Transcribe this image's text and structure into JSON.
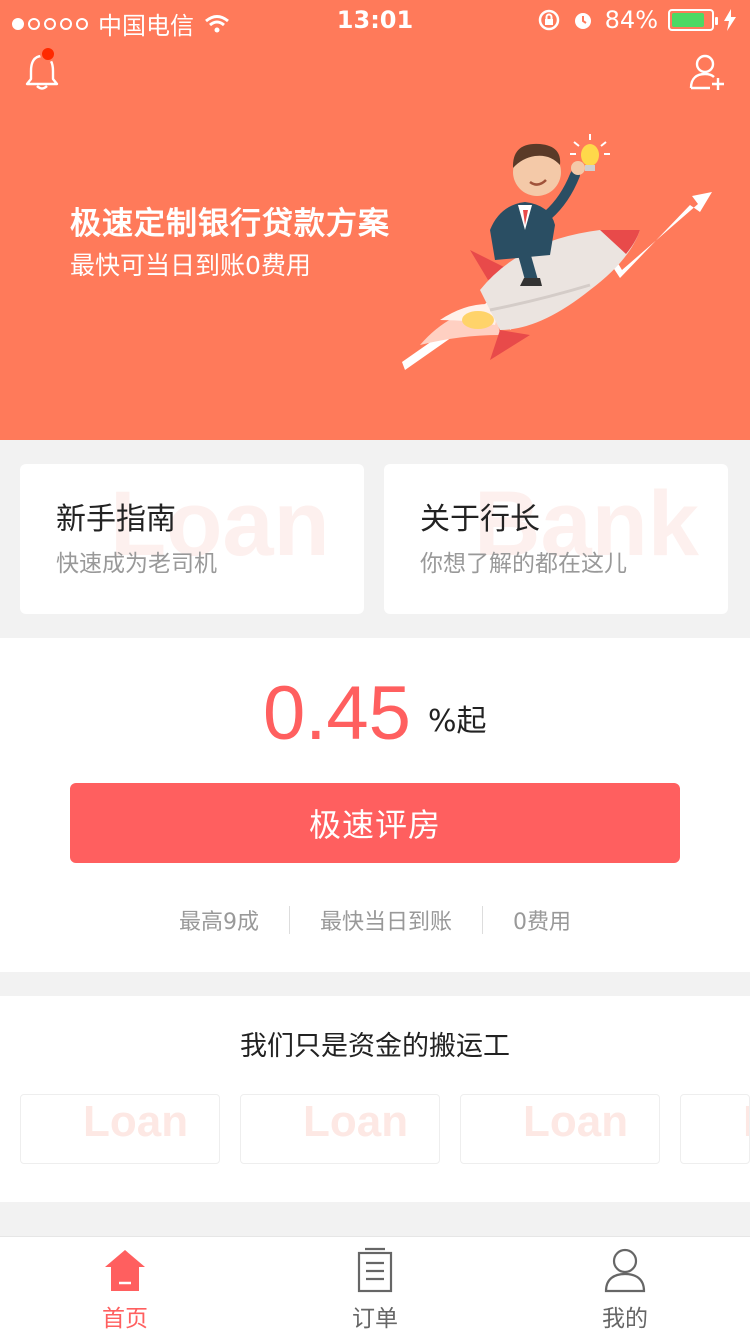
{
  "status_bar": {
    "carrier": "中国电信",
    "time": "13:01",
    "battery": "84%",
    "battery_level": 0.84
  },
  "header": {
    "notification_icon": "bell-icon",
    "add_user_icon": "add-user-icon"
  },
  "hero": {
    "title": "极速定制银行贷款方案",
    "subtitle": "最快可当日到账0费用"
  },
  "guides": [
    {
      "title": "新手指南",
      "subtitle": "快速成为老司机",
      "watermark": "Loan"
    },
    {
      "title": "关于行长",
      "subtitle": "你想了解的都在这儿",
      "watermark": "Bank"
    }
  ],
  "rate": {
    "value": "0.45",
    "unit": "%起"
  },
  "cta": {
    "label": "极速评房"
  },
  "features": [
    "最高9成",
    "最快当日到账",
    "0费用"
  ],
  "partners": {
    "title": "我们只是资金的搬运工",
    "logo_text": "Loan"
  },
  "tabbar": {
    "items": [
      {
        "label": "首页",
        "icon": "home-icon",
        "active": true
      },
      {
        "label": "订单",
        "icon": "order-list-icon",
        "active": false
      },
      {
        "label": "我的",
        "icon": "user-icon",
        "active": false
      }
    ]
  },
  "colors": {
    "hero": "#ff7a5a",
    "accent": "#ff5f5f",
    "badge": "#ff2a00",
    "battery": "#4cd964"
  }
}
